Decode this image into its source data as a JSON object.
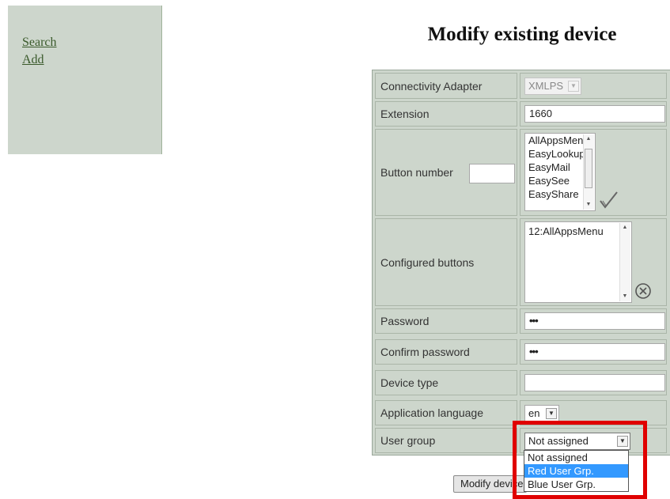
{
  "sidebar": {
    "links": [
      {
        "label": "Search"
      },
      {
        "label": "Add"
      }
    ]
  },
  "page": {
    "title": "Modify existing device"
  },
  "form": {
    "connectivity_adapter": {
      "label": "Connectivity Adapter",
      "value": "XMLPS"
    },
    "extension": {
      "label": "Extension",
      "value": "1660"
    },
    "button_number": {
      "label": "Button number",
      "value": "",
      "options": [
        "AllAppsMenu",
        "EasyLookup",
        "EasyMail",
        "EasySee",
        "EasyShare"
      ]
    },
    "configured_buttons": {
      "label": "Configured buttons",
      "items": [
        "12:AllAppsMenu"
      ]
    },
    "password": {
      "label": "Password",
      "value": "•••"
    },
    "confirm_password": {
      "label": "Confirm password",
      "value": "•••"
    },
    "device_type": {
      "label": "Device type",
      "value": ""
    },
    "application_language": {
      "label": "Application language",
      "value": "en"
    },
    "user_group": {
      "label": "User group",
      "value": "Not assigned",
      "options": [
        "Not assigned",
        "Red User Grp.",
        "Blue User Grp."
      ],
      "highlighted": "Red User Grp."
    },
    "submit_label": "Modify device"
  },
  "icons": {
    "add": "check-icon",
    "remove": "circle-x-icon"
  },
  "colors": {
    "panel": "#cdd6cc",
    "highlight": "#3399ff",
    "annotation": "#e00000"
  }
}
